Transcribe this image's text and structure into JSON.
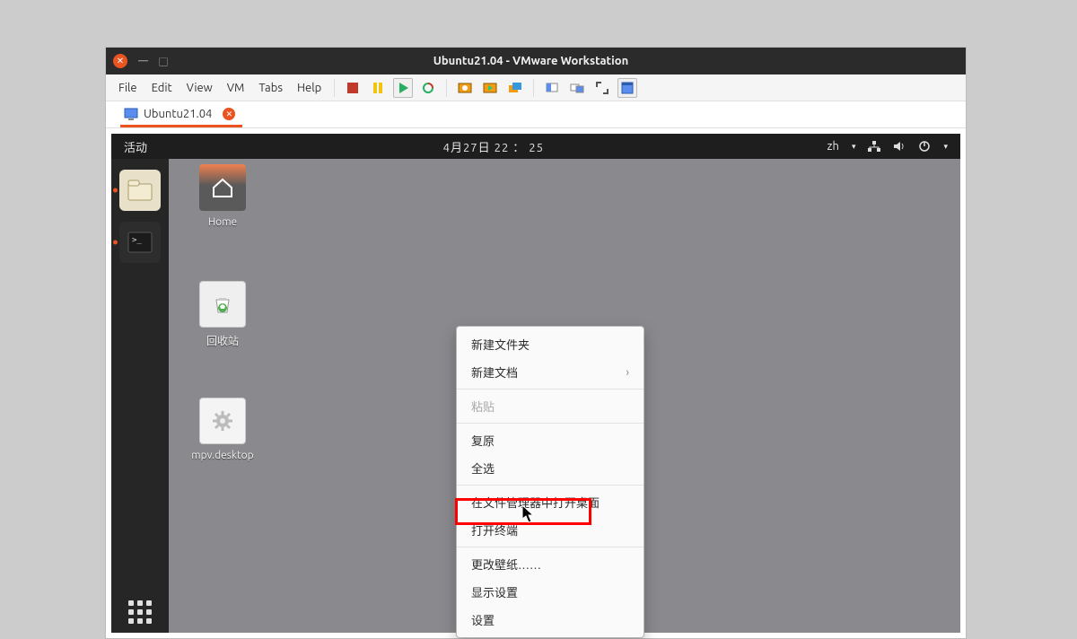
{
  "window": {
    "title": "Ubuntu21.04 - VMware Workstation",
    "menus": [
      "File",
      "Edit",
      "View",
      "VM",
      "Tabs",
      "Help"
    ],
    "tab_label": "Ubuntu21.04"
  },
  "guest": {
    "activities": "活动",
    "clock": "4月27日  22 ： 25",
    "input_method": "zh",
    "desktop_icons": {
      "home": "Home",
      "trash": "回收站",
      "mpv": "mpv.desktop"
    },
    "context_menu": {
      "new_folder": "新建文件夹",
      "new_document": "新建文档",
      "paste": "粘贴",
      "restore": "复原",
      "select_all": "全选",
      "open_desktop_in_fm": "在文件管理器中打开桌面",
      "open_terminal": "打开终端",
      "change_wallpaper": "更改壁纸……",
      "display_settings": "显示设置",
      "settings": "设置"
    }
  },
  "annotation": {
    "highlighted_item": "open_terminal"
  }
}
